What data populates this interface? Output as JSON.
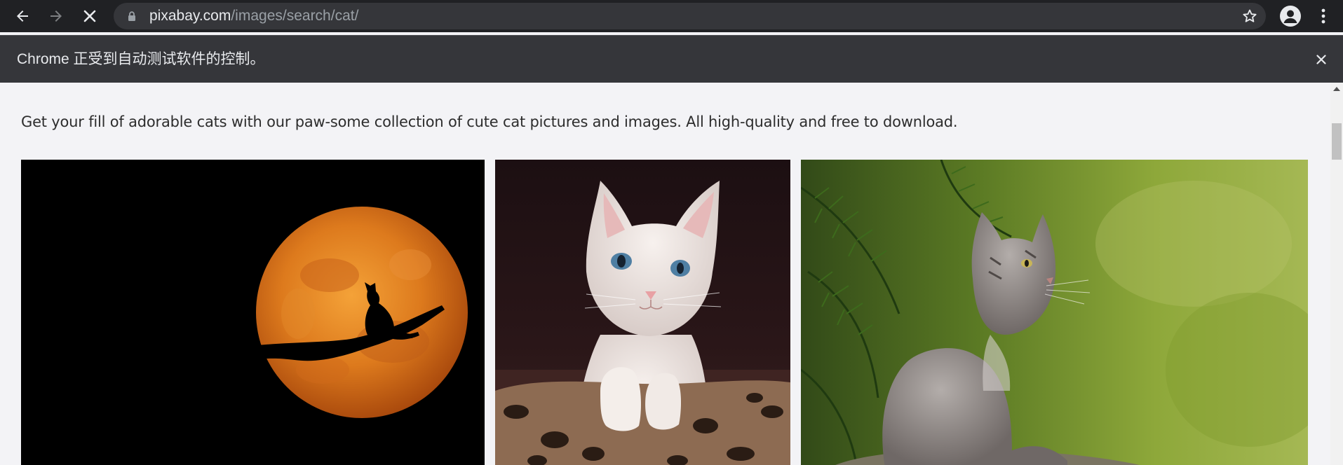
{
  "browser": {
    "url_host": "pixabay.com",
    "url_path": "/images/search/cat/",
    "icons": {
      "back": "back-arrow-icon",
      "forward": "forward-arrow-icon",
      "stop": "stop-loading-icon",
      "lock": "lock-icon",
      "bookmark": "star-icon",
      "profile": "profile-icon",
      "menu": "more-vert-icon"
    }
  },
  "infobar": {
    "message": "Chrome 正受到自动测试软件的控制。",
    "close_icon": "close-icon"
  },
  "page": {
    "intro": "Get your fill of adorable cats with our paw-some collection of cute cat pictures and images. All high-quality and free to download.",
    "images": [
      {
        "subject": "cat silhouette on a branch in front of an orange moon"
      },
      {
        "subject": "white kitten with blue eyes on a leopard-print cushion"
      },
      {
        "subject": "grey kitten sitting in front of green pine branches"
      }
    ]
  },
  "colors": {
    "chrome_dark": "#202124",
    "omnibox": "#35363a",
    "page_bg": "#f3f3f6",
    "moon": "#e07a1c"
  }
}
